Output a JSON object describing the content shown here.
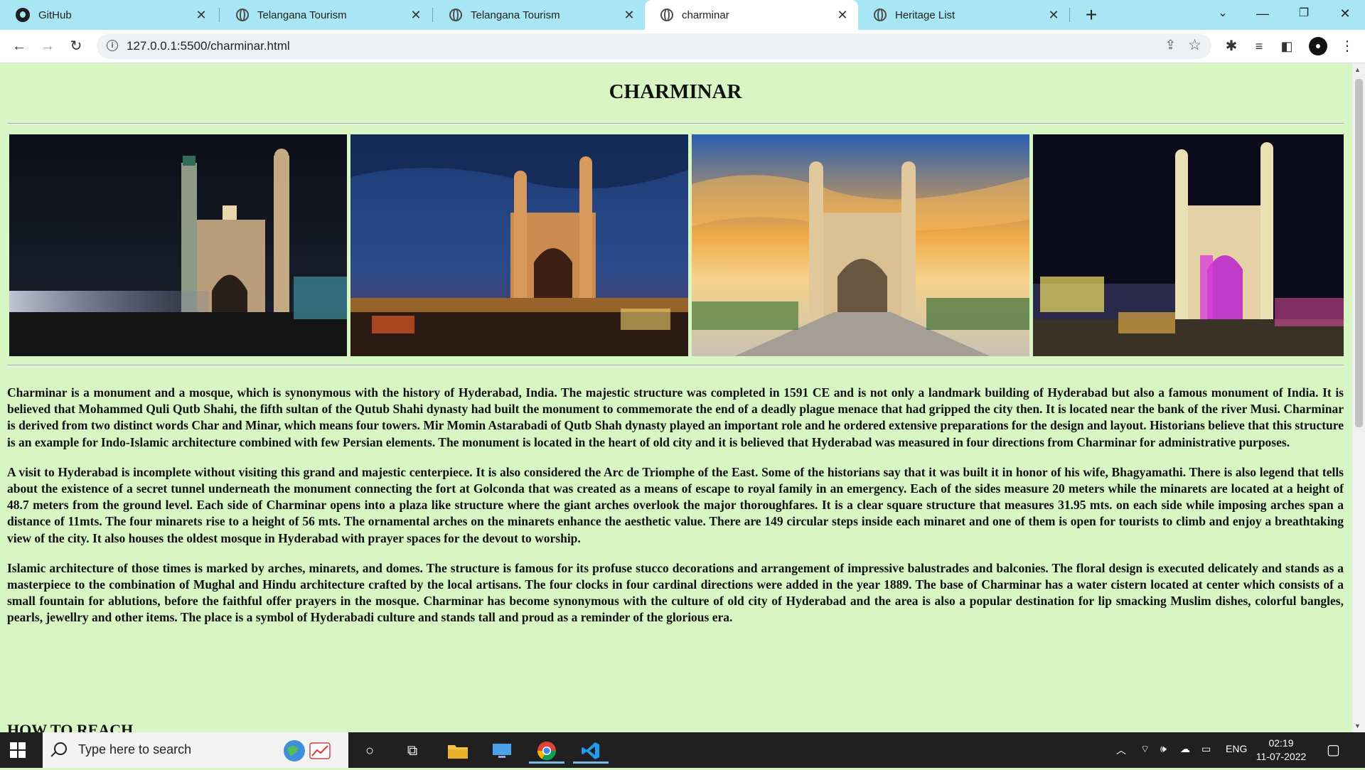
{
  "browser": {
    "tabs": [
      {
        "title": "GitHub",
        "icon": "github-icon",
        "active": false
      },
      {
        "title": "Telangana Tourism",
        "icon": "globe-icon",
        "active": false
      },
      {
        "title": "Telangana Tourism",
        "icon": "globe-icon",
        "active": false
      },
      {
        "title": "charminar",
        "icon": "globe-icon",
        "active": true
      },
      {
        "title": "Heritage List",
        "icon": "globe-icon",
        "active": false
      }
    ],
    "new_tab_symbol": "+",
    "url": "127.0.0.1:5500/charminar.html"
  },
  "page": {
    "title": "CHARMINAR",
    "gallery_captions": [
      "Charminar at night with traffic light trails",
      "Charminar at dusk above the night market",
      "Charminar under a sunset sky with plaza",
      "Charminar at night with colourful lighting"
    ],
    "paragraphs": [
      "Charminar is a monument and a mosque, which is synonymous with the history of Hyderabad, India. The majestic structure was completed in 1591 CE and is not only a landmark building of Hyderabad but also a famous monument of India. It is believed that Mohammed Quli Qutb Shahi, the fifth sultan of the Qutub Shahi dynasty had built the monument to commemorate the end of a deadly plague menace that had gripped the city then. It is located near the bank of the river Musi. Charminar is derived from two distinct words Char and Minar, which means four towers. Mir Momin Astarabadi of Qutb Shah dynasty played an important role and he ordered extensive preparations for the design and layout. Historians believe that this structure is an example for Indo-Islamic architecture combined with few Persian elements. The monument is located in the heart of old city and it is believed that Hyderabad was measured in four directions from Charminar for administrative purposes.",
      "A visit to Hyderabad is incomplete without visiting this grand and majestic centerpiece. It is also considered the Arc de Triomphe of the East. Some of the historians say that it was built it in honor of his wife, Bhagyamathi. There is also legend that tells about the existence of a secret tunnel underneath the monument connecting the fort at Golconda that was created as a means of escape to royal family in an emergency. Each of the sides measure 20 meters while the minarets are located at a height of 48.7 meters from the ground level. Each side of Charminar opens into a plaza like structure where the giant arches overlook the major thoroughfares. It is a clear square structure that measures 31.95 mts. on each side while imposing arches span a distance of 11mts. The four minarets rise to a height of 56 mts. The ornamental arches on the minarets enhance the aesthetic value. There are 149 circular steps inside each minaret and one of them is open for tourists to climb and enjoy a breathtaking view of the city. It also houses the oldest mosque in Hyderabad with prayer spaces for the devout to worship.",
      "Islamic architecture of those times is marked by arches, minarets, and domes. The structure is famous for its profuse stucco decorations and arrangement of impressive balustrades and balconies. The floral design is executed delicately and stands as a masterpiece to the combination of Mughal and Hindu architecture crafted by the local artisans. The four clocks in four cardinal directions were added in the year 1889. The base of Charminar has a water cistern located at center which consists of a small fountain for ablutions, before the faithful offer prayers in the mosque. Charminar has become synonymous with the culture of old city of Hyderabad and the area is also a popular destination for lip smacking Muslim dishes, colorful bangles, pearls, jewellry and other items. The place is a symbol of Hyderabadi culture and stands tall and proud as a reminder of the glorious era."
    ],
    "section_heading": "HOW TO REACH",
    "background_color": "#d8f5c4"
  },
  "taskbar": {
    "search_placeholder": "Type here to search",
    "language": "ENG",
    "time": "02:19",
    "date": "11-07-2022"
  }
}
